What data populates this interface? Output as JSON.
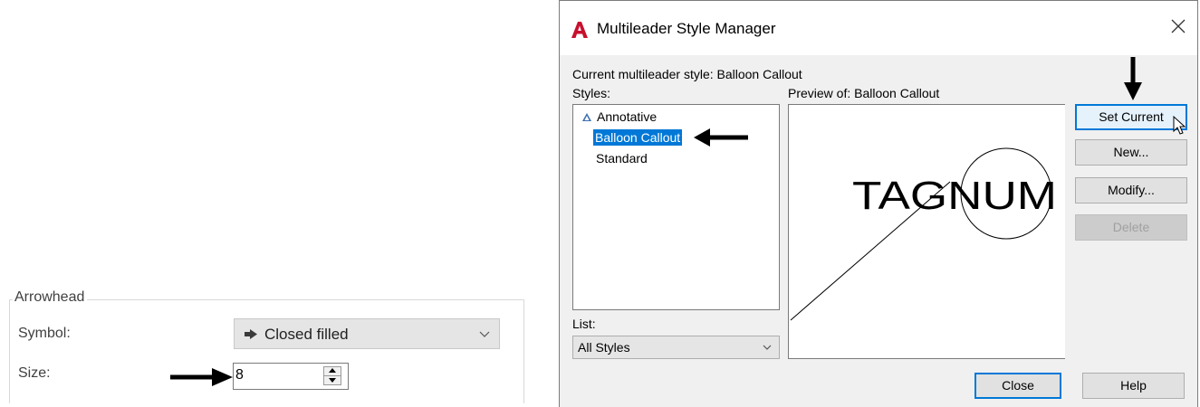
{
  "arrowhead_panel": {
    "group_title": "Arrowhead",
    "symbol_label": "Symbol:",
    "symbol_value": "Closed filled",
    "size_label": "Size:",
    "size_value": "8"
  },
  "dialog": {
    "title": "Multileader Style Manager",
    "current_style_text": "Current multileader style: Balloon Callout",
    "styles_label": "Styles:",
    "styles": [
      {
        "label": "Annotative",
        "icon": "annotative-icon",
        "selected": false
      },
      {
        "label": "Balloon Callout",
        "selected": true
      },
      {
        "label": "Standard",
        "selected": false
      }
    ],
    "preview_label": "Preview of: Balloon Callout",
    "preview_text": "TAGNUM",
    "list_label": "List:",
    "list_value": "All Styles",
    "buttons": {
      "set_current": "Set Current",
      "new": "New...",
      "modify": "Modify...",
      "delete": "Delete",
      "close": "Close",
      "help": "Help"
    }
  },
  "colors": {
    "selection": "#0078d7",
    "app_icon": "#c8102e",
    "dialog_bg": "#f0f0f0"
  }
}
